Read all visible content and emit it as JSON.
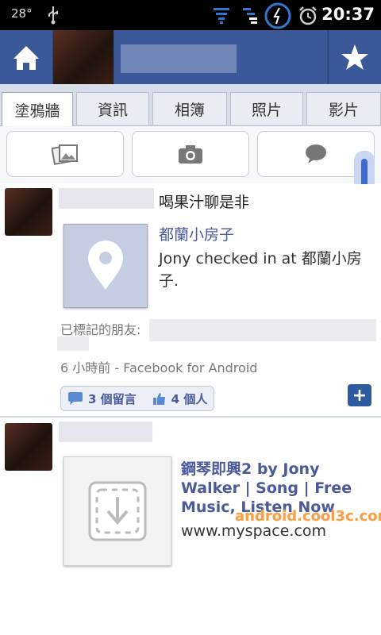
{
  "status_bar": {
    "temperature": "28°",
    "time": "20:37"
  },
  "tabs": [
    {
      "label": "塗鴉牆",
      "active": true
    },
    {
      "label": "資訊",
      "active": false
    },
    {
      "label": "相簿",
      "active": false
    },
    {
      "label": "照片",
      "active": false
    },
    {
      "label": "影片",
      "active": false
    }
  ],
  "actions": {
    "icons": [
      "photos-icon",
      "camera-icon",
      "comment-icon"
    ]
  },
  "stories": [
    {
      "suffix_text": "喝果汁聊是非",
      "link_title": "都蘭小房子",
      "link_desc": "Jony checked in at 都蘭小房子.",
      "tagged_label": "已標記的朋友:",
      "meta": "6 小時前 - Facebook for Android",
      "comments": "3 個留言",
      "likes": "4 個人"
    },
    {
      "link_title": "鋼琴即興2 by Jony Walker | Song | Free Music, Listen Now",
      "link_url": "www.myspace.com"
    }
  ],
  "watermark": "android.cool3c.com",
  "colors": {
    "brand": "#3b5998",
    "link": "#4a5a9a",
    "meta": "#777777"
  }
}
